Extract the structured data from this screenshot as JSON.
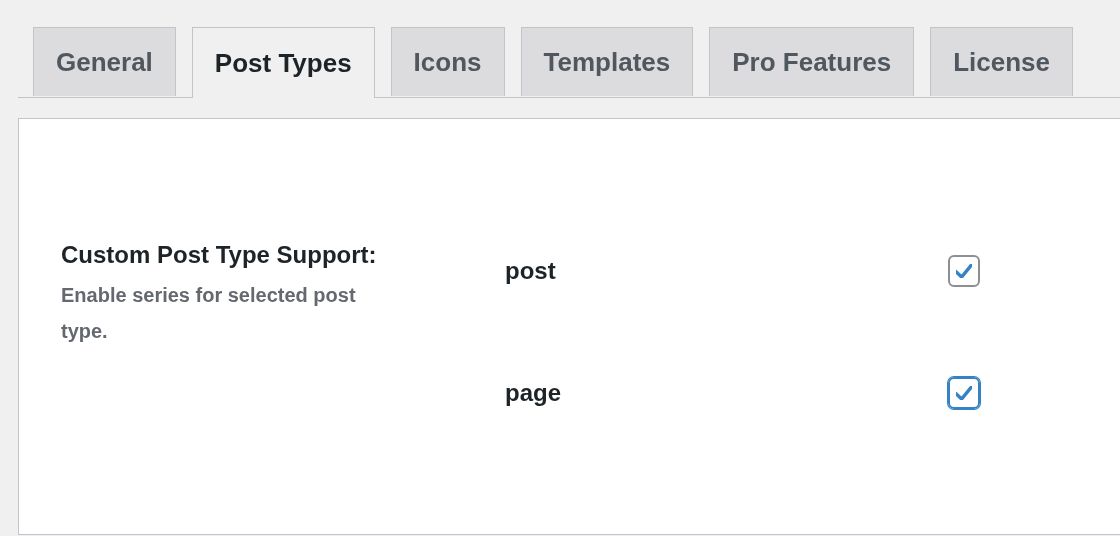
{
  "tabs": [
    {
      "label": "General",
      "selected": false
    },
    {
      "label": "Post Types",
      "selected": true
    },
    {
      "label": "Icons",
      "selected": false
    },
    {
      "label": "Templates",
      "selected": false
    },
    {
      "label": "Pro Features",
      "selected": false
    },
    {
      "label": "License",
      "selected": false
    }
  ],
  "setting": {
    "label": "Custom Post Type Support:",
    "description": "Enable series for selected post type.",
    "options": [
      {
        "label": "post",
        "checked": true,
        "focused": false
      },
      {
        "label": "page",
        "checked": true,
        "focused": true
      }
    ]
  }
}
